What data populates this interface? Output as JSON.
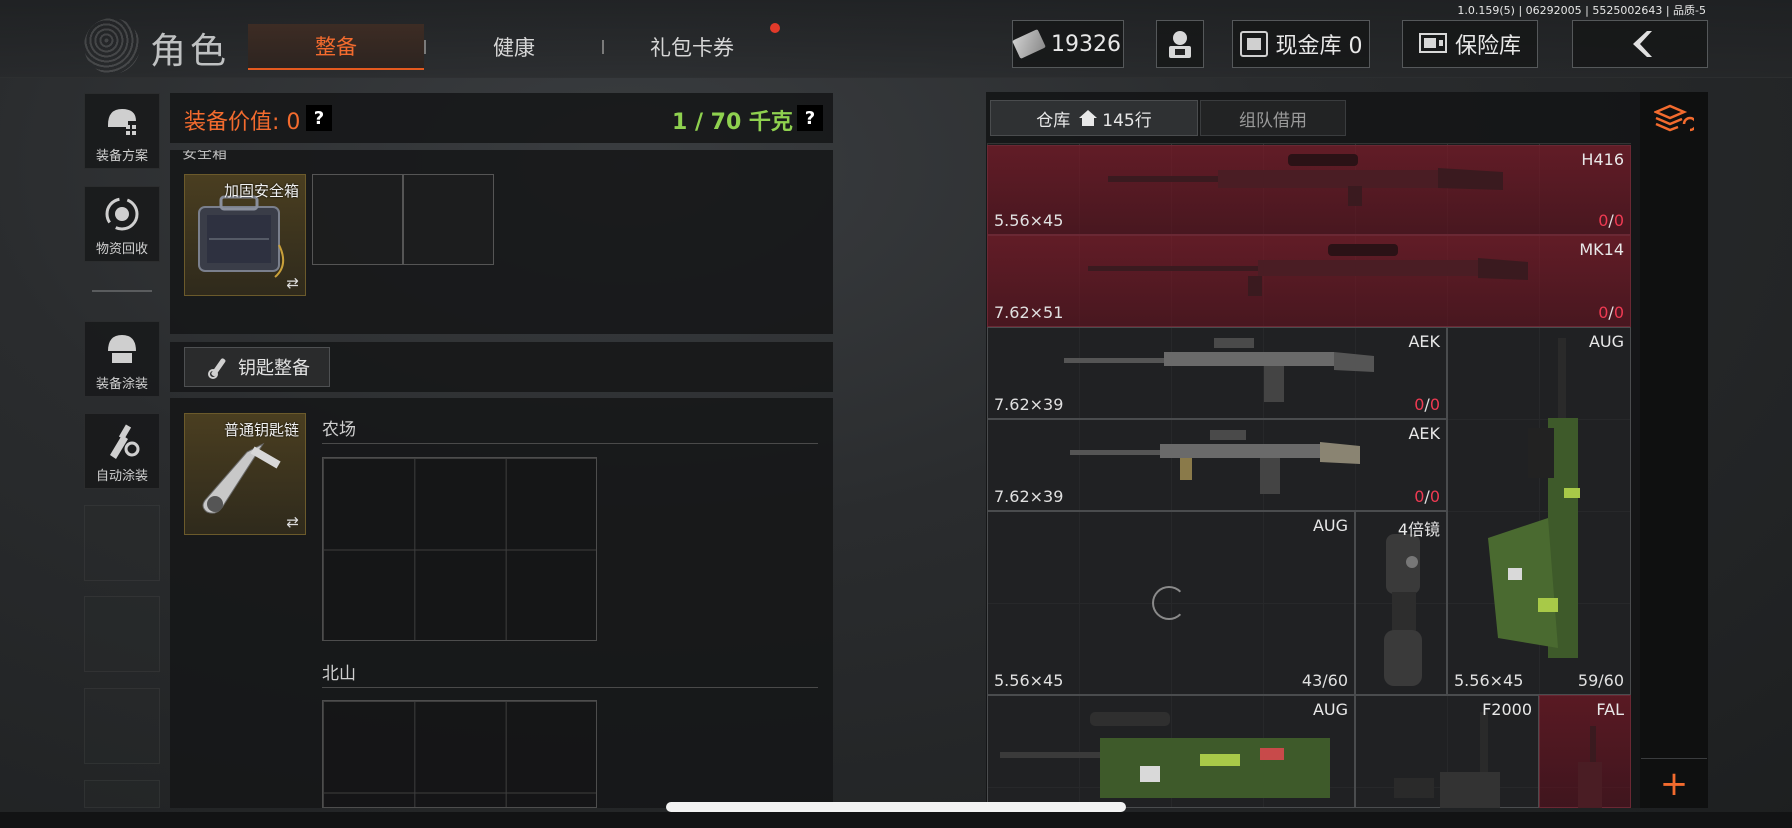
{
  "version_text": "1.0.159(5) | 06292005 | 5525002643 | 品质-5",
  "header": {
    "title": "角色",
    "tabs": [
      {
        "label": "整备",
        "active": true
      },
      {
        "label": "健康",
        "active": false
      },
      {
        "label": "礼包卡券",
        "active": false,
        "badge": true
      }
    ],
    "currency": "19326",
    "cash_vault": "现金库 0",
    "insurance": "保险库",
    "back_icon": "chevron-left-icon"
  },
  "sidebar": {
    "items": [
      {
        "label": "装备方案",
        "icon": "helmet-plan-icon"
      },
      {
        "label": "物资回收",
        "icon": "recycle-icon"
      },
      {
        "label": "装备涂装",
        "icon": "helmet-paint-icon"
      },
      {
        "label": "自动涂装",
        "icon": "brush-gear-icon"
      }
    ]
  },
  "equipment": {
    "value_label": "装备价值: 0",
    "weight": "1 / 70 千克",
    "help": "?",
    "safe_box_title": "安全箱",
    "safe_box_item": "加固安全箱",
    "key_button": "钥匙整备",
    "key_item": "普通钥匙链",
    "locations": [
      "农场",
      "北山"
    ]
  },
  "warehouse": {
    "tabs": [
      {
        "label": "仓库",
        "count": "145行",
        "active": true
      },
      {
        "label": "组队借用",
        "active": false
      }
    ],
    "items": [
      {
        "name": "H416",
        "caliber": "5.56×45",
        "ammo_cur": "0",
        "ammo_max": "0",
        "rarity": "red"
      },
      {
        "name": "MK14",
        "caliber": "7.62×51",
        "ammo_cur": "0",
        "ammo_max": "0",
        "rarity": "red"
      },
      {
        "name": "AEK",
        "caliber": "7.62×39",
        "ammo_cur": "0",
        "ammo_max": "0",
        "rarity": "gray"
      },
      {
        "name": "AEK",
        "caliber": "7.62×39",
        "ammo_cur": "0",
        "ammo_max": "0",
        "rarity": "gray"
      },
      {
        "name": "AUG",
        "caliber": "5.56×45",
        "ammo": "59/60",
        "rarity": "gray"
      },
      {
        "name": "AUG",
        "caliber": "5.56×45",
        "ammo": "43/60",
        "rarity": "gray"
      },
      {
        "name": "4倍镜",
        "rarity": "gray"
      },
      {
        "name": "AUG",
        "rarity": "gray"
      },
      {
        "name": "F2000",
        "rarity": "gray"
      },
      {
        "name": "FAL",
        "rarity": "red"
      }
    ],
    "add_button": "+"
  },
  "colors": {
    "accent": "#f36b2e",
    "weight": "#8fd14f",
    "red_rarity": "#6e1c28",
    "ammo_zero": "#ee3a52"
  }
}
